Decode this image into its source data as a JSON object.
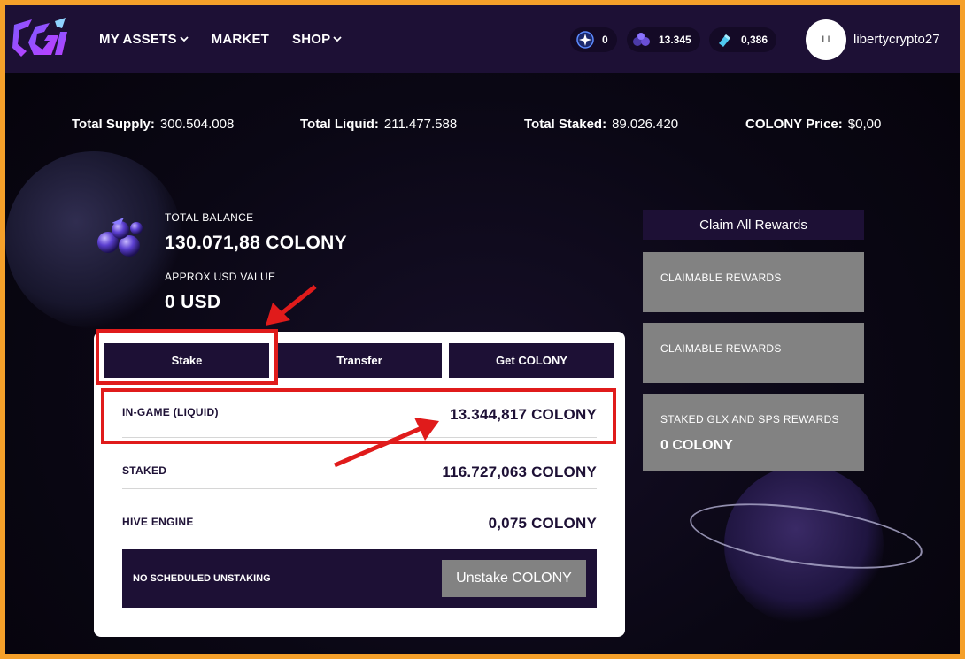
{
  "nav": {
    "items": [
      {
        "label": "MY ASSETS",
        "has_dropdown": true
      },
      {
        "label": "MARKET",
        "has_dropdown": false
      },
      {
        "label": "SHOP",
        "has_dropdown": true
      }
    ]
  },
  "header_stats": [
    {
      "icon": "star-badge-icon",
      "value": "0"
    },
    {
      "icon": "colony-token-icon",
      "value": "13.345"
    },
    {
      "icon": "crystal-icon",
      "value": "0,386"
    }
  ],
  "user": {
    "initials": "LI",
    "name": "libertycrypto27"
  },
  "supply": {
    "total_supply_label": "Total Supply:",
    "total_supply": "300.504.008",
    "total_liquid_label": "Total Liquid:",
    "total_liquid": "211.477.588",
    "total_staked_label": "Total Staked:",
    "total_staked": "89.026.420",
    "price_label": "COLONY Price:",
    "price": "$0,00"
  },
  "balance": {
    "total_label": "TOTAL BALANCE",
    "total_value": "130.071,88 COLONY",
    "usd_label": "APPROX USD VALUE",
    "usd_value": "0 USD"
  },
  "rewards": {
    "claim_all_label": "Claim All Rewards",
    "cards": [
      {
        "label": "CLAIMABLE REWARDS",
        "value": ""
      },
      {
        "label": "CLAIMABLE REWARDS",
        "value": ""
      },
      {
        "label": "STAKED GLX AND SPS REWARDS",
        "value": "0 COLONY"
      }
    ]
  },
  "tabs": [
    {
      "label": "Stake"
    },
    {
      "label": "Transfer"
    },
    {
      "label": "Get COLONY"
    }
  ],
  "holdings": [
    {
      "label": "IN-GAME (LIQUID)",
      "value": "13.344,817 COLONY"
    },
    {
      "label": "STAKED",
      "value": "116.727,063 COLONY"
    },
    {
      "label": "HIVE ENGINE",
      "value": "0,075 COLONY"
    }
  ],
  "unstaking": {
    "label": "NO SCHEDULED UNSTAKING",
    "button_label": "Unstake COLONY"
  },
  "colors": {
    "brand_dark": "#1d1035",
    "frame": "#f5a02a",
    "highlight": "#e01b1b",
    "disabled_gray": "#828282"
  }
}
